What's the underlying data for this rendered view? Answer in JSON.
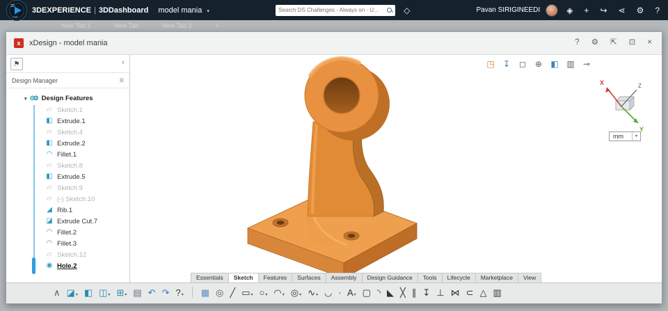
{
  "colors": {
    "topbar_bg": "#15212c",
    "part_orange": "#e8913a",
    "accent_blue": "#2d9fe0",
    "x_axis_red": "#d93a2f",
    "y_axis_green": "#58a832"
  },
  "topbar": {
    "logo": {
      "label_top": "3D",
      "label_bottom": "V.R"
    },
    "brand": {
      "bold": "3DEXPERIENCE",
      "sep": "|",
      "app": "3DDashboard",
      "context": "model mania",
      "caret": "▾"
    },
    "search": {
      "placeholder": "Search DS Challenges - Always on - U..."
    },
    "tag_glyph": "◇",
    "user": {
      "name": "Pavan SIRIGINEEDI"
    },
    "right_icons": [
      {
        "name": "compose-icon",
        "glyph": "◈"
      },
      {
        "name": "add-icon",
        "glyph": "+"
      },
      {
        "name": "share-icon",
        "glyph": "↪"
      },
      {
        "name": "community-icon",
        "glyph": "⋖"
      },
      {
        "name": "tools-icon",
        "glyph": "⚙"
      },
      {
        "name": "help-icon",
        "glyph": "?"
      }
    ]
  },
  "tabsbar": {
    "tabs": [
      "New Tab 1",
      "New Tab",
      "New Tab 2"
    ],
    "add_label": "+"
  },
  "window": {
    "title": "xDesign - model mania",
    "app_badge": "x",
    "header_icons": [
      {
        "name": "help-icon",
        "glyph": "?"
      },
      {
        "name": "settings-icon",
        "glyph": "⚙"
      },
      {
        "name": "maximize-icon",
        "glyph": "⇱"
      },
      {
        "name": "popout-icon",
        "glyph": "⊡"
      },
      {
        "name": "close-icon",
        "glyph": "×"
      }
    ]
  },
  "panel": {
    "collapse_glyph": "‹",
    "pin_tool_glyph": "⚑",
    "title": "Design Manager",
    "menu_glyph": "≡",
    "root": {
      "caret": "▾",
      "label": "Design Features"
    },
    "items": [
      {
        "name": "tree-item-sketch-1",
        "label": "Sketch.1",
        "type": "sketch",
        "dim": true
      },
      {
        "name": "tree-item-extrude-1",
        "label": "Extrude.1",
        "type": "extrude"
      },
      {
        "name": "tree-item-sketch-4",
        "label": "Sketch.4",
        "type": "sketch",
        "dim": true
      },
      {
        "name": "tree-item-extrude-2",
        "label": "Extrude.2",
        "type": "extrude"
      },
      {
        "name": "tree-item-fillet-1",
        "label": "Fillet.1",
        "type": "fillet"
      },
      {
        "name": "tree-item-sketch-8",
        "label": "Sketch.8",
        "type": "sketch",
        "dim": true
      },
      {
        "name": "tree-item-extrude-5",
        "label": "Extrude.5",
        "type": "extrude"
      },
      {
        "name": "tree-item-sketch-9",
        "label": "Sketch.9",
        "type": "sketch",
        "dim": true
      },
      {
        "name": "tree-item-sketch-10",
        "label": "(-)  Sketch.10",
        "type": "sketch",
        "dim": true
      },
      {
        "name": "tree-item-rib-1",
        "label": "Rib.1",
        "type": "rib"
      },
      {
        "name": "tree-item-extrude-cut-7",
        "label": "Extrude Cut.7",
        "type": "extrude-cut"
      },
      {
        "name": "tree-item-fillet-2",
        "label": "Fillet.2",
        "type": "fillet"
      },
      {
        "name": "tree-item-fillet-3",
        "label": "Fillet.3",
        "type": "fillet"
      },
      {
        "name": "tree-item-sketch-12",
        "label": "Sketch.12",
        "type": "sketch",
        "dim": true
      },
      {
        "name": "tree-item-hole-2",
        "label": "Hole.2",
        "type": "hole",
        "selected": true
      }
    ]
  },
  "viewport": {
    "toolbar": [
      {
        "name": "insert-component-icon",
        "glyph": "◳",
        "color": "#d2802f"
      },
      {
        "name": "section-view-icon",
        "glyph": "↧",
        "color": "#2f89b5"
      },
      {
        "name": "view-cube-icon",
        "glyph": "◻",
        "color": "#55606a"
      },
      {
        "name": "zoom-icon",
        "glyph": "⊕",
        "color": "#55606a"
      },
      {
        "name": "shaded-view-icon",
        "glyph": "◧",
        "color": "#2f89b5"
      },
      {
        "name": "measure-icon",
        "glyph": "▥",
        "color": "#55606a"
      },
      {
        "name": "pin-icon",
        "glyph": "⊸",
        "color": "#55606a"
      }
    ],
    "axis": {
      "x": "X",
      "y": "Y",
      "z": "Z"
    },
    "units": {
      "value": "mm",
      "caret": "▾"
    }
  },
  "bottom_tabs": {
    "items": [
      {
        "name": "tab-essentials",
        "label": "Essentials"
      },
      {
        "name": "tab-sketch",
        "label": "Sketch",
        "active": true
      },
      {
        "name": "tab-features",
        "label": "Features"
      },
      {
        "name": "tab-surfaces",
        "label": "Surfaces"
      },
      {
        "name": "tab-assembly",
        "label": "Assembly"
      },
      {
        "name": "tab-design-guidance",
        "label": "Design Guidance"
      },
      {
        "name": "tab-tools",
        "label": "Tools"
      },
      {
        "name": "tab-lifecycle",
        "label": "Lifecycle"
      },
      {
        "name": "tab-marketplace",
        "label": "Marketplace"
      },
      {
        "name": "tab-view",
        "label": "View"
      }
    ]
  },
  "toolbar": {
    "icons": [
      {
        "name": "toolbar-collapse-icon",
        "glyph": "∧",
        "color": "#555555"
      },
      {
        "name": "sketch-new-icon",
        "glyph": "◪",
        "caret": "▾",
        "color": "#2f89b5"
      },
      {
        "name": "sketch-update-icon",
        "glyph": "◧",
        "color": "#2f89b5"
      },
      {
        "name": "save-icon",
        "glyph": "◫",
        "caret": "▾",
        "color": "#2f89b5"
      },
      {
        "name": "export-icon",
        "glyph": "⊞",
        "caret": "▾",
        "color": "#2f89b5"
      },
      {
        "name": "paste-icon",
        "glyph": "▤",
        "color": "#667180"
      },
      {
        "name": "undo-icon",
        "glyph": "↶",
        "color": "#3b74c9"
      },
      {
        "name": "redo-icon",
        "glyph": "↷",
        "color": "#3b74c9"
      },
      {
        "name": "help-icon",
        "glyph": "?",
        "caret": "▾",
        "color": "#333333"
      },
      {
        "sep": true
      },
      {
        "name": "grid-icon",
        "glyph": "▦",
        "color": "#5a8fc0"
      },
      {
        "name": "sketch-inspect-icon",
        "glyph": "◎",
        "color": "#555555"
      },
      {
        "name": "line-icon",
        "glyph": "╱",
        "color": "#333333"
      },
      {
        "name": "rectangle-icon",
        "glyph": "▭",
        "caret": "▾",
        "color": "#333333"
      },
      {
        "name": "circle-icon",
        "glyph": "○",
        "caret": "▾",
        "color": "#333333"
      },
      {
        "name": "arc-icon",
        "glyph": "◠",
        "caret": "▾",
        "color": "#333333"
      },
      {
        "name": "perimeter-circle-icon",
        "glyph": "◎",
        "caret": "▾",
        "color": "#333333"
      },
      {
        "name": "spline-icon",
        "glyph": "∿",
        "caret": "▾",
        "color": "#333333"
      },
      {
        "name": "conic-icon",
        "glyph": "◡",
        "color": "#333333"
      },
      {
        "name": "point-icon",
        "glyph": "∙",
        "color": "#333333"
      },
      {
        "name": "text-icon",
        "glyph": "A",
        "caret": "▾",
        "color": "#333333"
      },
      {
        "name": "slot-icon",
        "glyph": "▢",
        "color": "#333333"
      },
      {
        "name": "corner-fillet-icon",
        "glyph": "◝",
        "color": "#333333"
      },
      {
        "name": "chamfer-icon",
        "glyph": "◣",
        "color": "#333333"
      },
      {
        "name": "trim-icon",
        "glyph": "╳",
        "color": "#333333"
      },
      {
        "name": "offset-icon",
        "glyph": "∥",
        "color": "#333333"
      },
      {
        "name": "project-icon",
        "glyph": "↧",
        "color": "#333333"
      },
      {
        "name": "constraint-icon",
        "glyph": "⊥",
        "color": "#333333"
      },
      {
        "name": "mirror-icon",
        "glyph": "⋈",
        "color": "#333333"
      },
      {
        "name": "offset-curve-icon",
        "glyph": "⊂",
        "color": "#333333"
      },
      {
        "name": "construction-icon",
        "glyph": "△",
        "color": "#333333"
      },
      {
        "name": "layers-icon",
        "glyph": "▥",
        "color": "#333333"
      }
    ]
  }
}
